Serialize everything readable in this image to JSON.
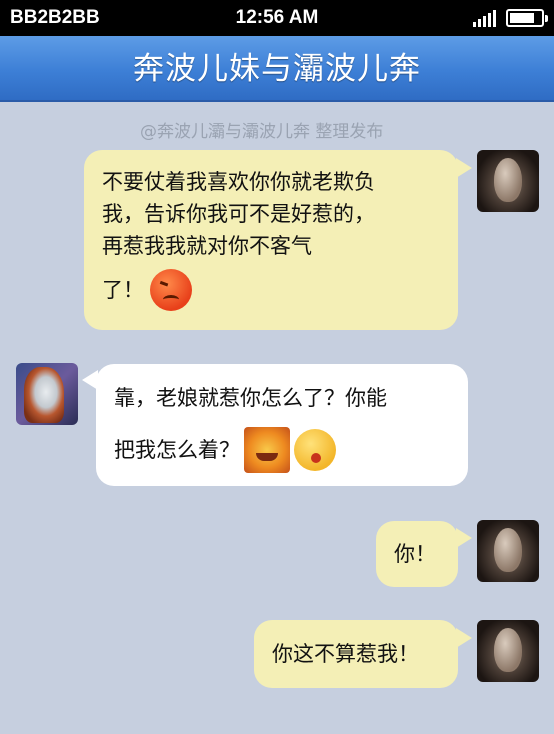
{
  "status_bar": {
    "carrier": "BB2B2BB",
    "time": "12:56 AM"
  },
  "header": {
    "title": "奔波儿妹与灞波儿奔"
  },
  "attribution": "@奔波儿灞与灞波儿奔 整理发布",
  "messages": [
    {
      "sender": "him",
      "lines": [
        "不要仗着我喜欢你你就老欺负",
        "我，告诉你我可不是好惹的，",
        "再惹我我就对你不客气",
        "了！"
      ],
      "emoji": [
        "angry-face-icon"
      ]
    },
    {
      "sender": "her",
      "lines": [
        "靠，老娘就惹你怎么了？你能",
        "把我怎么着？"
      ],
      "emoji": [
        "sun-face-icon",
        "tongue-out-face-icon"
      ]
    },
    {
      "sender": "him",
      "lines": [
        "你！"
      ]
    },
    {
      "sender": "him",
      "lines": [
        "你这不算惹我！"
      ]
    }
  ],
  "colors": {
    "background": "#c6cfdf",
    "title_bar": "#3d7fd6",
    "my_bubble": "#f4efb6",
    "their_bubble": "#ffffff"
  }
}
